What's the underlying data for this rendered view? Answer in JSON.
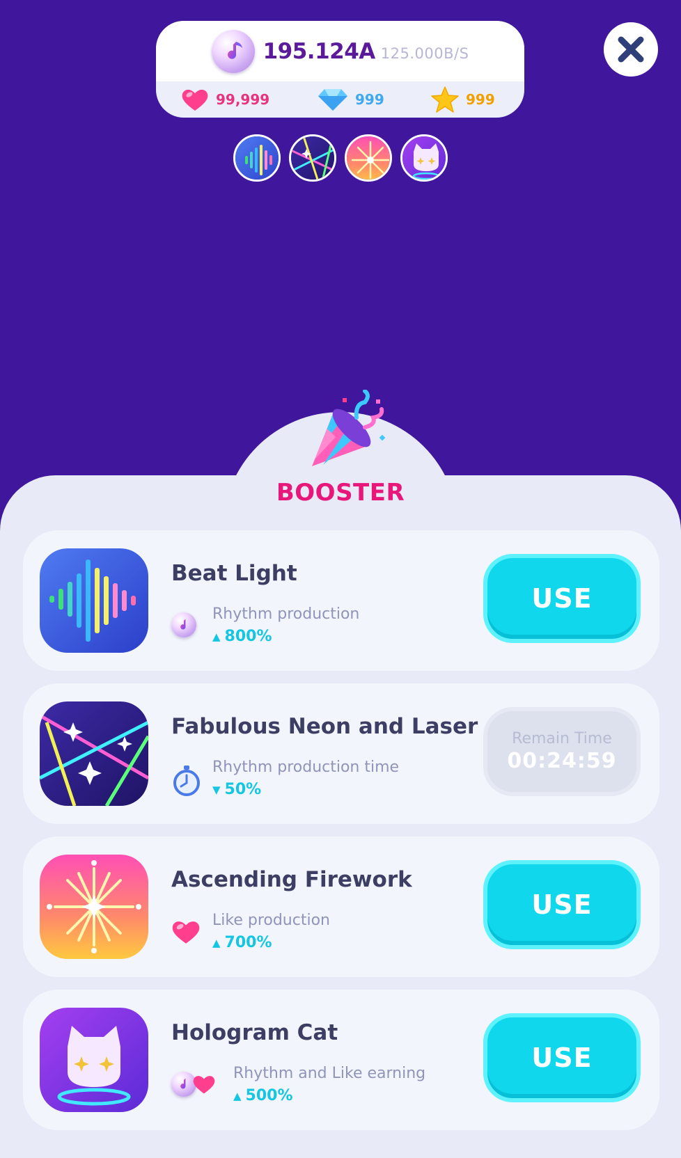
{
  "header": {
    "rhythm_amount": "195.124A",
    "rhythm_rate": "125.000B/S",
    "likes": "99,999",
    "gems": "999",
    "stars": "999",
    "close_icon": "close-icon"
  },
  "active_boosters": [
    {
      "icon": "beat-light-icon"
    },
    {
      "icon": "neon-laser-icon"
    },
    {
      "icon": "firework-icon"
    },
    {
      "icon": "hologram-cat-icon"
    }
  ],
  "sheet": {
    "title": "BOOSTER",
    "icon": "party-popper-icon"
  },
  "boosters": [
    {
      "name": "Beat Light",
      "effect_label": "Rhythm production",
      "effect_value": "800%",
      "direction": "up",
      "action": "USE"
    },
    {
      "name": "Fabulous Neon and Laser",
      "effect_label": "Rhythm production time",
      "effect_value": "50%",
      "direction": "down",
      "remain_label": "Remain Time",
      "remain_time": "00:24:59"
    },
    {
      "name": "Ascending Firework",
      "effect_label": "Like production",
      "effect_value": "700%",
      "direction": "up",
      "action": "USE"
    },
    {
      "name": "Hologram Cat",
      "effect_label": "Rhythm and Like earning",
      "effect_value": "500%",
      "direction": "up",
      "action": "USE"
    }
  ],
  "colors": {
    "background": "#3f169c",
    "accent": "#10d7ec",
    "title": "#e8177a"
  }
}
